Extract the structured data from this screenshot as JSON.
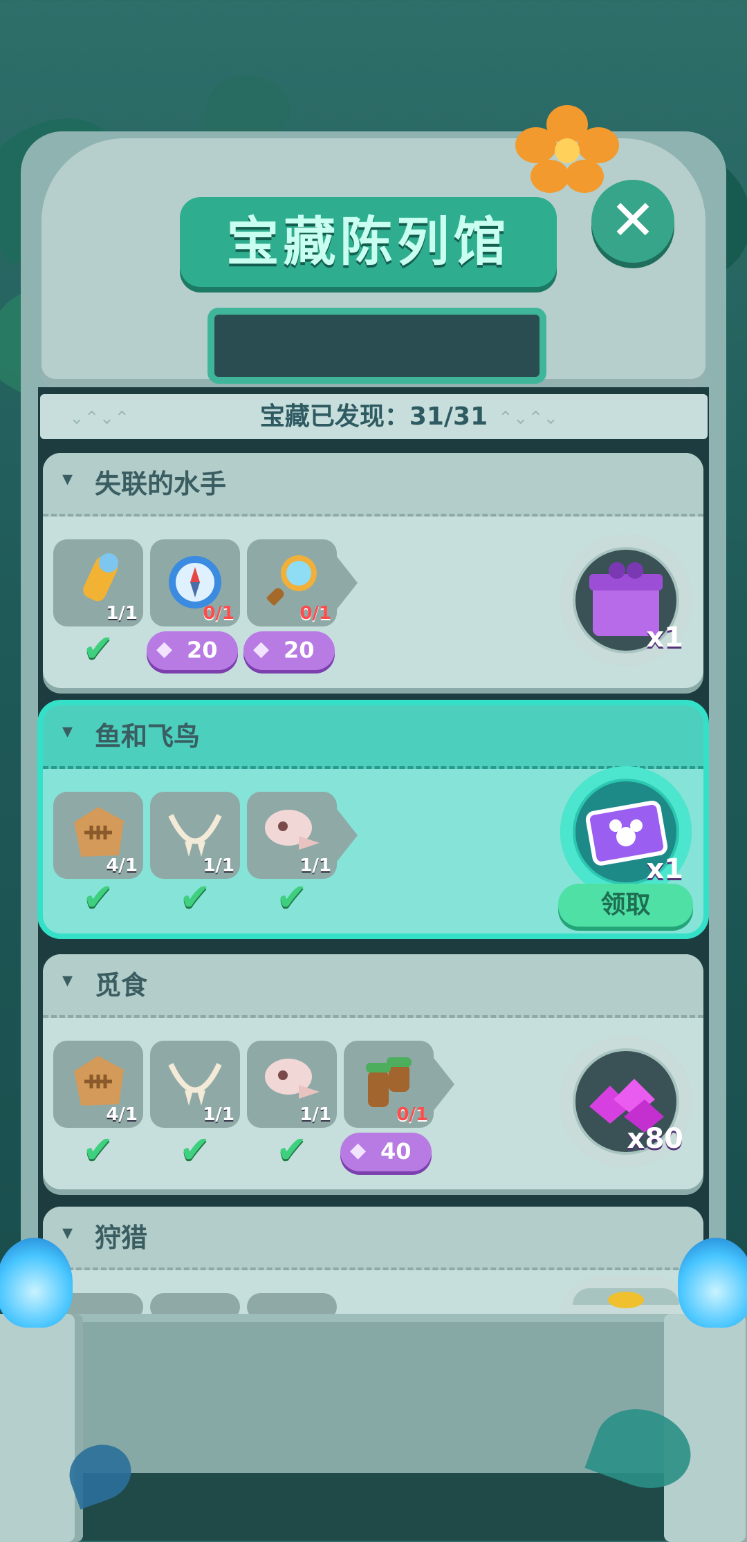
{
  "header": {
    "title": "宝藏陈列馆",
    "close_icon": "close-icon"
  },
  "progress": {
    "label": "宝藏已发现：31/31"
  },
  "sets": [
    {
      "name": "失联的水手",
      "active": false,
      "items": [
        {
          "icon": "telescope-icon",
          "count": "1/1",
          "owned": true
        },
        {
          "icon": "compass-icon",
          "count": "0/1",
          "owned": false,
          "gem_cost": "20"
        },
        {
          "icon": "magnifier-icon",
          "count": "0/1",
          "owned": false,
          "gem_cost": "20"
        }
      ],
      "reward": {
        "icon": "gift-box-icon",
        "qty": "x1"
      }
    },
    {
      "name": "鱼和飞鸟",
      "active": true,
      "items": [
        {
          "icon": "fish-fossil-icon",
          "count": "4/1",
          "owned": true
        },
        {
          "icon": "bone-necklace-icon",
          "count": "1/1",
          "owned": true
        },
        {
          "icon": "bird-skull-icon",
          "count": "1/1",
          "owned": true
        }
      ],
      "reward": {
        "icon": "mickey-card-icon",
        "qty": "x1",
        "claim_label": "领取"
      }
    },
    {
      "name": "觅食",
      "active": false,
      "items": [
        {
          "icon": "fish-fossil-icon",
          "count": "4/1",
          "owned": true
        },
        {
          "icon": "bone-necklace-icon",
          "count": "1/1",
          "owned": true
        },
        {
          "icon": "bird-skull-icon",
          "count": "1/1",
          "owned": true
        },
        {
          "icon": "slingshot-icon",
          "count": "0/1",
          "owned": false,
          "gem_cost": "40"
        }
      ],
      "reward": {
        "icon": "gems-pile-icon",
        "qty": "x80"
      }
    },
    {
      "name": "狩猎",
      "active": false,
      "items": [],
      "reward": {
        "icon": "coin-icon",
        "qty": ""
      }
    }
  ],
  "colors": {
    "accent": "#34e0c7",
    "gem_button": "#b77be3",
    "check": "#3fd07f",
    "missing_count": "#ff4b4b"
  }
}
